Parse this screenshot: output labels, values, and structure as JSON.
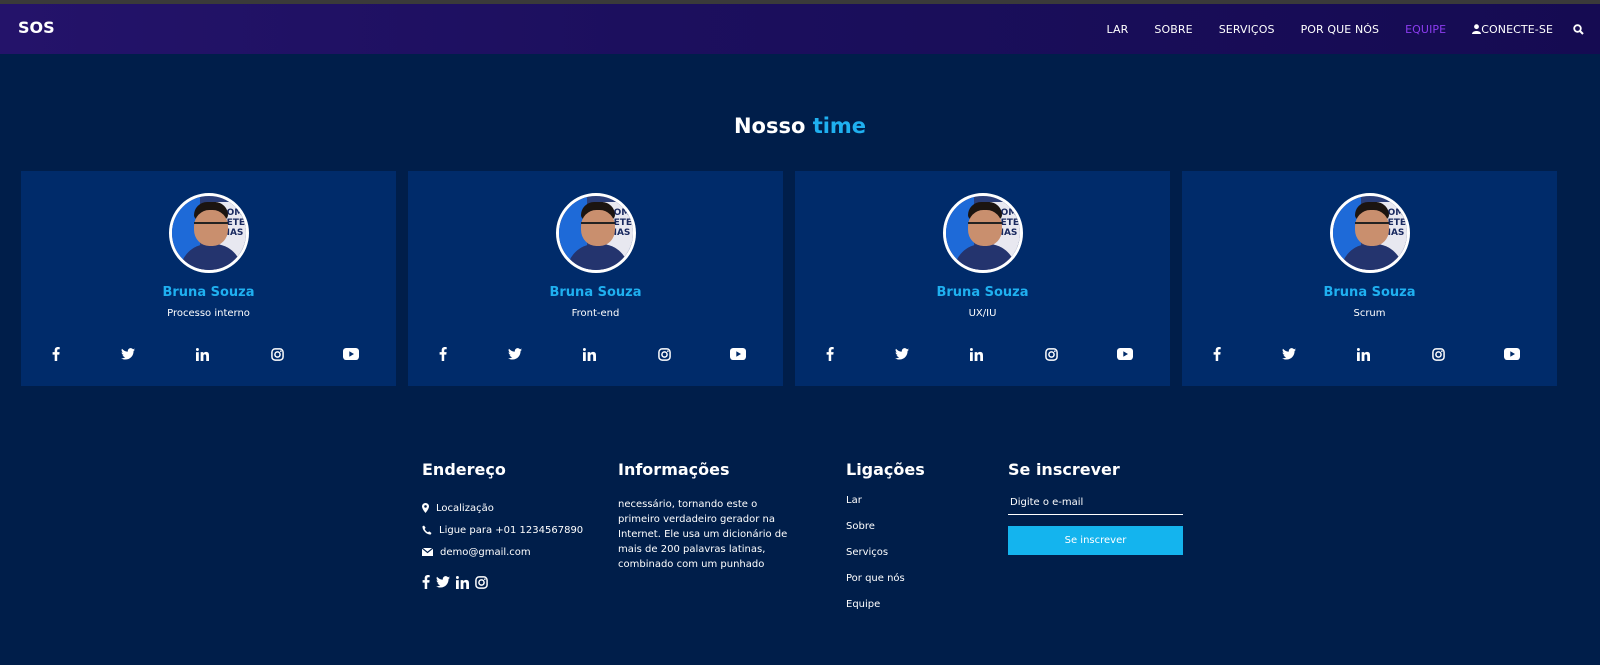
{
  "nav": {
    "brand": "SOS",
    "items": [
      {
        "label": "LAR",
        "active": false
      },
      {
        "label": "SOBRE",
        "active": false
      },
      {
        "label": "SERVIÇOS",
        "active": false
      },
      {
        "label": "POR QUE NÓS",
        "active": false
      },
      {
        "label": "EQUIPE",
        "active": true
      }
    ],
    "login_label": "CONECTE-SE",
    "login_icon": "user-icon",
    "search_icon": "search-icon",
    "active_color": "#8c3cf0"
  },
  "team": {
    "title_main": "Nosso",
    "title_accent": "time",
    "accent_color": "#1fb0f0",
    "members": [
      {
        "name": "Bruna Souza",
        "role": "Processo interno"
      },
      {
        "name": "Bruna Souza",
        "role": "Front-end"
      },
      {
        "name": "Bruna Souza",
        "role": "UX/IU"
      },
      {
        "name": "Bruna Souza",
        "role": "Scrum"
      }
    ],
    "avatar_text": "COM PETE CIAS",
    "social_icons": [
      "facebook-icon",
      "twitter-icon",
      "linkedin-icon",
      "instagram-icon",
      "youtube-icon"
    ]
  },
  "footer": {
    "address": {
      "heading": "Endereço",
      "location": "Localização",
      "phone": "Ligue para +01 1234567890",
      "email": "demo@gmail.com",
      "social_icons": [
        "facebook-icon",
        "twitter-icon",
        "linkedin-icon",
        "instagram-icon"
      ]
    },
    "info": {
      "heading": "Informações",
      "text": "necessário, tornando este o primeiro verdadeiro gerador na Internet. Ele usa um dicionário de mais de 200 palavras latinas, combinado com um punhado"
    },
    "links": {
      "heading": "Ligações",
      "items": [
        "Lar",
        "Sobre",
        "Serviços",
        "Por que nós",
        "Equipe"
      ]
    },
    "subscribe": {
      "heading": "Se inscrever",
      "placeholder": "Digite o e-mail",
      "button_label": "Se inscrever",
      "button_color": "#14b4ee"
    }
  }
}
